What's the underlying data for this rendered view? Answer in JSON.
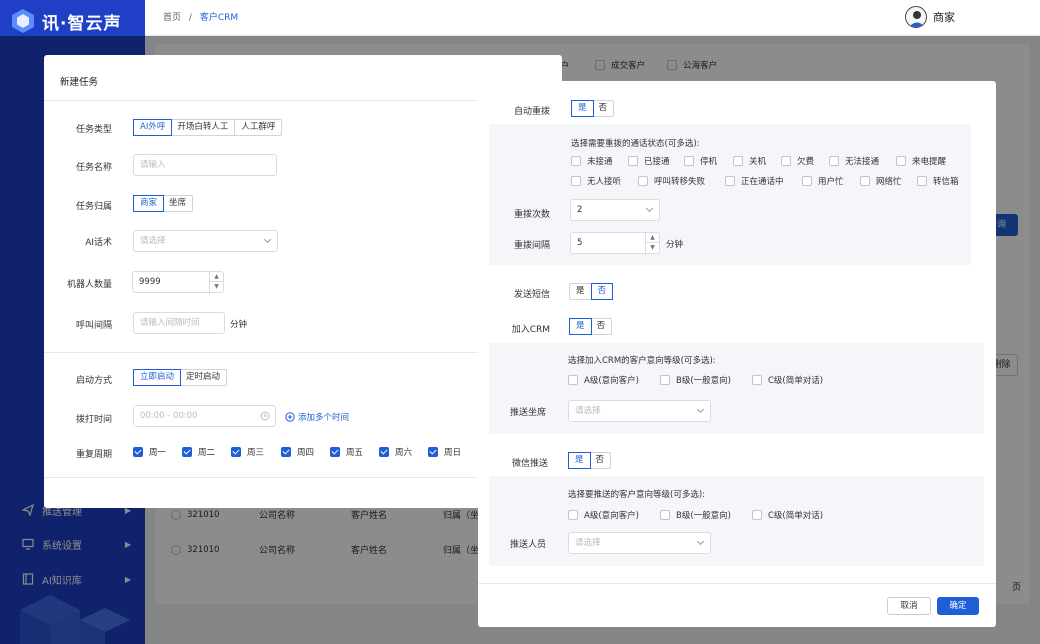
{
  "sidebar": {
    "logo": "讯·智云声",
    "items": [
      {
        "label": "推送管理",
        "icon": "send-icon"
      },
      {
        "label": "系统设置",
        "icon": "settings-icon"
      },
      {
        "label": "AI知识库",
        "icon": "book-icon"
      }
    ]
  },
  "header": {
    "breadcrumb_home": "首页",
    "breadcrumb_sep": "/",
    "breadcrumb_current": "客户CRM",
    "user_name": "商家"
  },
  "background": {
    "filter_options": [
      "户",
      "成交客户",
      "公海客户"
    ],
    "query_button": "询",
    "delete_button": "删除",
    "rows": [
      {
        "id": "321010",
        "company": "公司名称",
        "customer": "客户姓名",
        "owner": "归属（坐"
      },
      {
        "id": "321010",
        "company": "公司名称",
        "customer": "客户姓名",
        "owner": "归属（坐"
      }
    ],
    "page_suffix": "页"
  },
  "dialog1": {
    "title": "新建任务",
    "task_type_label": "任务类型",
    "task_type_options": [
      "AI外呼",
      "开场白转人工",
      "人工群呼"
    ],
    "task_type_selected": 0,
    "task_name_label": "任务名称",
    "task_name_placeholder": "请输入",
    "owner_label": "任务归属",
    "owner_options": [
      "商家",
      "坐席"
    ],
    "script_label": "AI话术",
    "script_placeholder": "请选择",
    "robot_count_label": "机器人数量",
    "robot_count_value": "9999",
    "interval_label": "呼叫间隔",
    "interval_placeholder": "请输入间隔时间",
    "interval_unit": "分钟",
    "start_mode_label": "启动方式",
    "start_mode_options": [
      "立即启动",
      "定时启动"
    ],
    "dial_time_label": "拨打时间",
    "dial_time_placeholder": "00:00 - 00:00",
    "add_time_link": "添加多个时间",
    "repeat_label": "重复周期",
    "weekdays": [
      "周一",
      "周二",
      "周三",
      "周四",
      "周五",
      "周六",
      "周日"
    ]
  },
  "dialog2": {
    "redial_label": "自动重拨",
    "yes": "是",
    "no": "否",
    "redial_hint": "选择需要重拨的通话状态(可多选):",
    "redial_states_row1": [
      "未接通",
      "已接通",
      "停机",
      "关机",
      "欠费",
      "无法接通",
      "来电提醒"
    ],
    "redial_states_row2": [
      "无人接听",
      "呼叫转移失败",
      "正在通话中",
      "用户忙",
      "网络忙",
      "转信箱"
    ],
    "redial_times_label": "重拨次数",
    "redial_times_value": "2",
    "redial_interval_label": "重拨间隔",
    "redial_interval_value": "5",
    "redial_interval_unit": "分钟",
    "sms_label": "发送短信",
    "crm_label": "加入CRM",
    "crm_hint": "选择加入CRM的客户意向等级(可多选):",
    "levels": [
      "A级(意向客户)",
      "B级(一般意向)",
      "C级(简单对话)"
    ],
    "push_seat_label": "推送坐席",
    "select_placeholder": "请选择",
    "wechat_label": "微信推送",
    "wechat_hint": "选择要推送的客户意向等级(可多选):",
    "push_person_label": "推送人员",
    "cancel": "取消",
    "confirm": "确定"
  },
  "colors": {
    "primary": "#1f5fd6",
    "sidebar": "#1f3fc6"
  }
}
